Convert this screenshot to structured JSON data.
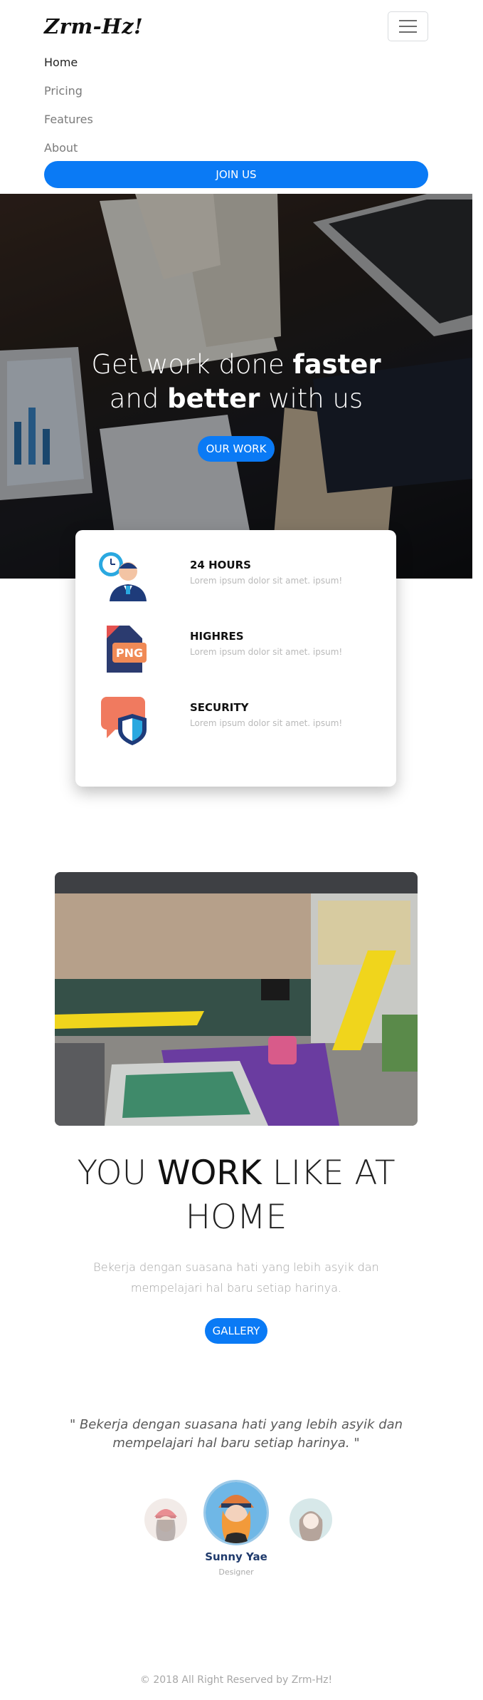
{
  "navbar": {
    "brand": "Zrm-Hz!",
    "toggler_icon": "menu-icon",
    "links": [
      {
        "label": "Home",
        "active": true
      },
      {
        "label": "Pricing",
        "active": false
      },
      {
        "label": "Features",
        "active": false
      },
      {
        "label": "About",
        "active": false
      }
    ],
    "join_label": "JOIN US"
  },
  "hero": {
    "title_part1": "Get work done ",
    "title_bold1": "faster",
    "title_part2": "and ",
    "title_bold2": "better",
    "title_part3": " with us",
    "button_label": "OUR WORK"
  },
  "features": [
    {
      "icon": "clock-person-icon",
      "title": "24 HOURS",
      "desc": "Lorem ipsum dolor sit amet. ipsum!"
    },
    {
      "icon": "png-file-icon",
      "title": "HIGHRES",
      "desc": "Lorem ipsum dolor sit amet. ipsum!"
    },
    {
      "icon": "shield-chat-icon",
      "title": "SECURITY",
      "desc": "Lorem ipsum dolor sit amet. ipsum!"
    }
  ],
  "work": {
    "title_part1": "YOU ",
    "title_bold": "WORK",
    "title_part2": " LIKE AT",
    "title_line2": "HOME",
    "desc": "Bekerja dengan suasana hati yang lebih asyik dan mempelajari hal baru setiap harinya.",
    "button_label": "GALLERY"
  },
  "testimonial": {
    "quote": "\" Bekerja dengan suasana hati yang lebih asyik dan mempelajari hal baru setiap harinya. \"",
    "name": "Sunny Yae",
    "role": "Designer"
  },
  "footer": {
    "text": "© 2018 All Right Reserved by Zrm-Hz!"
  },
  "colors": {
    "accent": "#0a7af5",
    "name": "#1f3a6c"
  }
}
